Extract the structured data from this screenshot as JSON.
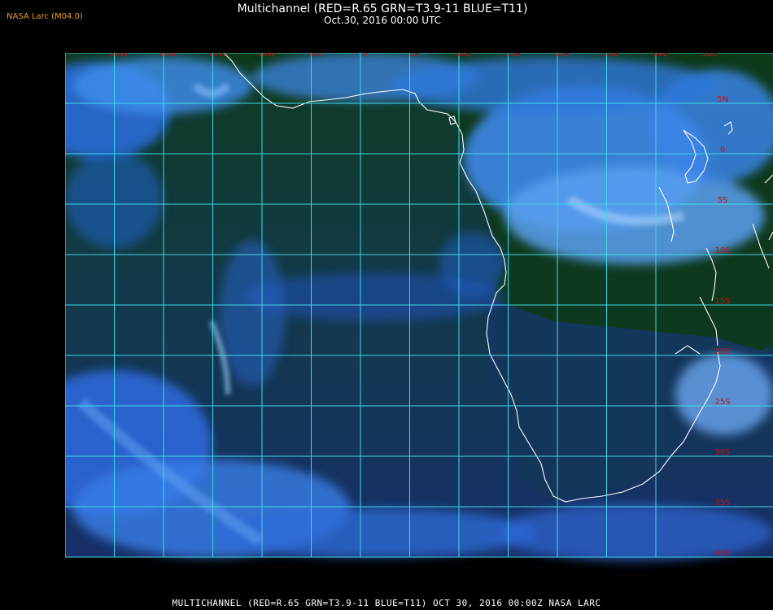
{
  "header": {
    "corner_label": "NASA Larc (M04.0)",
    "title": "Multichannel (RED=R.65 GRN=T3.9-11 BLUE=T11)",
    "subtitle": "Oct.30, 2016 00:00 UTC"
  },
  "map": {
    "longitude_labels": [
      "25W",
      "20W",
      "15W",
      "10W",
      "5W",
      "0",
      "5E",
      "10E",
      "15E",
      "20E",
      "25E",
      "30E",
      "35E"
    ],
    "latitude_labels": [
      "5N",
      "0",
      "5S",
      "10S",
      "15S",
      "20S",
      "25S",
      "30S",
      "35S",
      "40S"
    ],
    "grid_color": "#40d8e8",
    "label_color": "#cc1010",
    "coastline_color": "#ffffff"
  },
  "footer": {
    "caption": "MULTICHANNEL (RED=R.65 GRN=T3.9-11 BLUE=T11) OCT 30, 2016 00:00Z  NASA LARC"
  }
}
